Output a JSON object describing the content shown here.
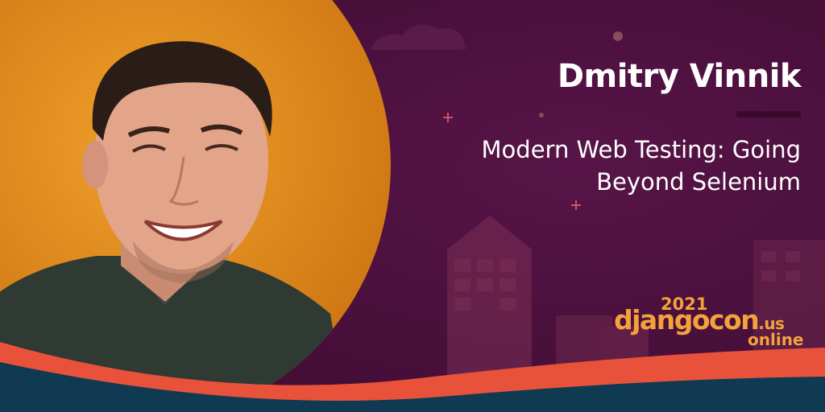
{
  "speaker": {
    "name": "Dmitry Vinnik"
  },
  "talk": {
    "title_line1": "Modern Web Testing: Going",
    "title_line2": "Beyond Selenium"
  },
  "event": {
    "year": "2021",
    "brand_main": "djangocon",
    "brand_suffix": ".us",
    "format": "online"
  },
  "photo": {
    "subject": "smiling man with short dark hair against an orange background"
  },
  "colors": {
    "background": "#4a0f3a",
    "photo_backdrop": "#e08c1a",
    "accent_orange": "#f4a23a",
    "wave_red": "#e8523a",
    "wave_navy": "#0f3a52",
    "text": "#ffffff"
  }
}
